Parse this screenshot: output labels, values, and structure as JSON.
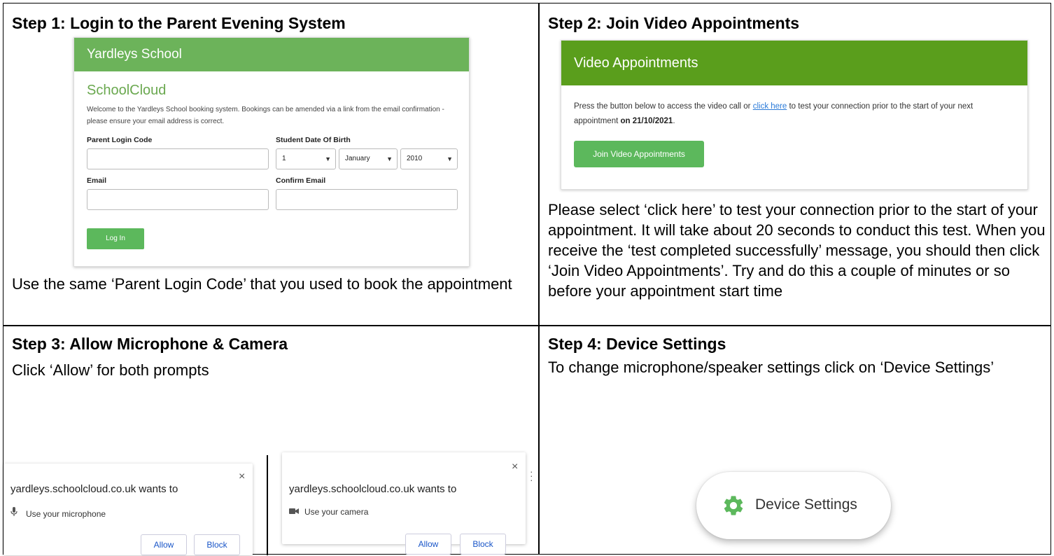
{
  "step1": {
    "title": "Step 1: Login to the Parent Evening System",
    "card": {
      "header": "Yardleys School",
      "subtitle": "SchoolCloud",
      "welcome": "Welcome to the Yardleys School booking system. Bookings can be amended via a link from the email confirmation - please ensure your email address is correct.",
      "login_code_label": "Parent Login Code",
      "dob_label": "Student Date Of Birth",
      "dob_day": "1",
      "dob_month": "January",
      "dob_year": "2010",
      "email_label": "Email",
      "confirm_email_label": "Confirm Email",
      "login_button": "Log In"
    },
    "caption": "Use the same ‘Parent Login Code’ that you used to book the appointment"
  },
  "step2": {
    "title": "Step 2: Join Video Appointments",
    "card": {
      "header": "Video Appointments",
      "text_before": "Press the button below to access the video call or ",
      "link": "click here",
      "text_after": " to test your connection prior to the start of your next appointment ",
      "date": "on 21/10/2021",
      "text_end": ".",
      "join_button": "Join Video Appointments"
    },
    "caption": "Please select ‘click here’ to test your connection prior to the start of your appointment. It will take about 20 seconds to conduct this test. When you receive the ‘test completed successfully’ message, you should then click ‘Join Video Appointments’. Try and do this a couple of minutes or so before your appointment start time"
  },
  "step3": {
    "title": "Step 3: Allow Microphone & Camera",
    "caption": "Click ‘Allow’ for both prompts",
    "prompt_mic": {
      "site": "yardleys.schoolcloud.co.uk wants to",
      "permission": "Use your microphone",
      "allow": "Allow",
      "block": "Block",
      "close": "×"
    },
    "prompt_cam": {
      "site": "yardleys.schoolcloud.co.uk wants to",
      "permission": "Use your camera",
      "allow": "Allow",
      "block": "Block",
      "close": "×"
    }
  },
  "step4": {
    "title": "Step 4: Device Settings",
    "caption": "To change microphone/speaker settings click on ‘Device Settings’",
    "button_label": "Device Settings"
  },
  "colors": {
    "login_header": "#6cb35a",
    "video_header": "#5a9e1c",
    "button_green": "#5cb85c",
    "gear_green": "#5cb85c",
    "link_blue": "#2a7ad8"
  },
  "icons": [
    "microphone-icon",
    "camera-icon",
    "close-icon",
    "gear-icon",
    "chevron-down-icon",
    "more-vert-icon"
  ]
}
